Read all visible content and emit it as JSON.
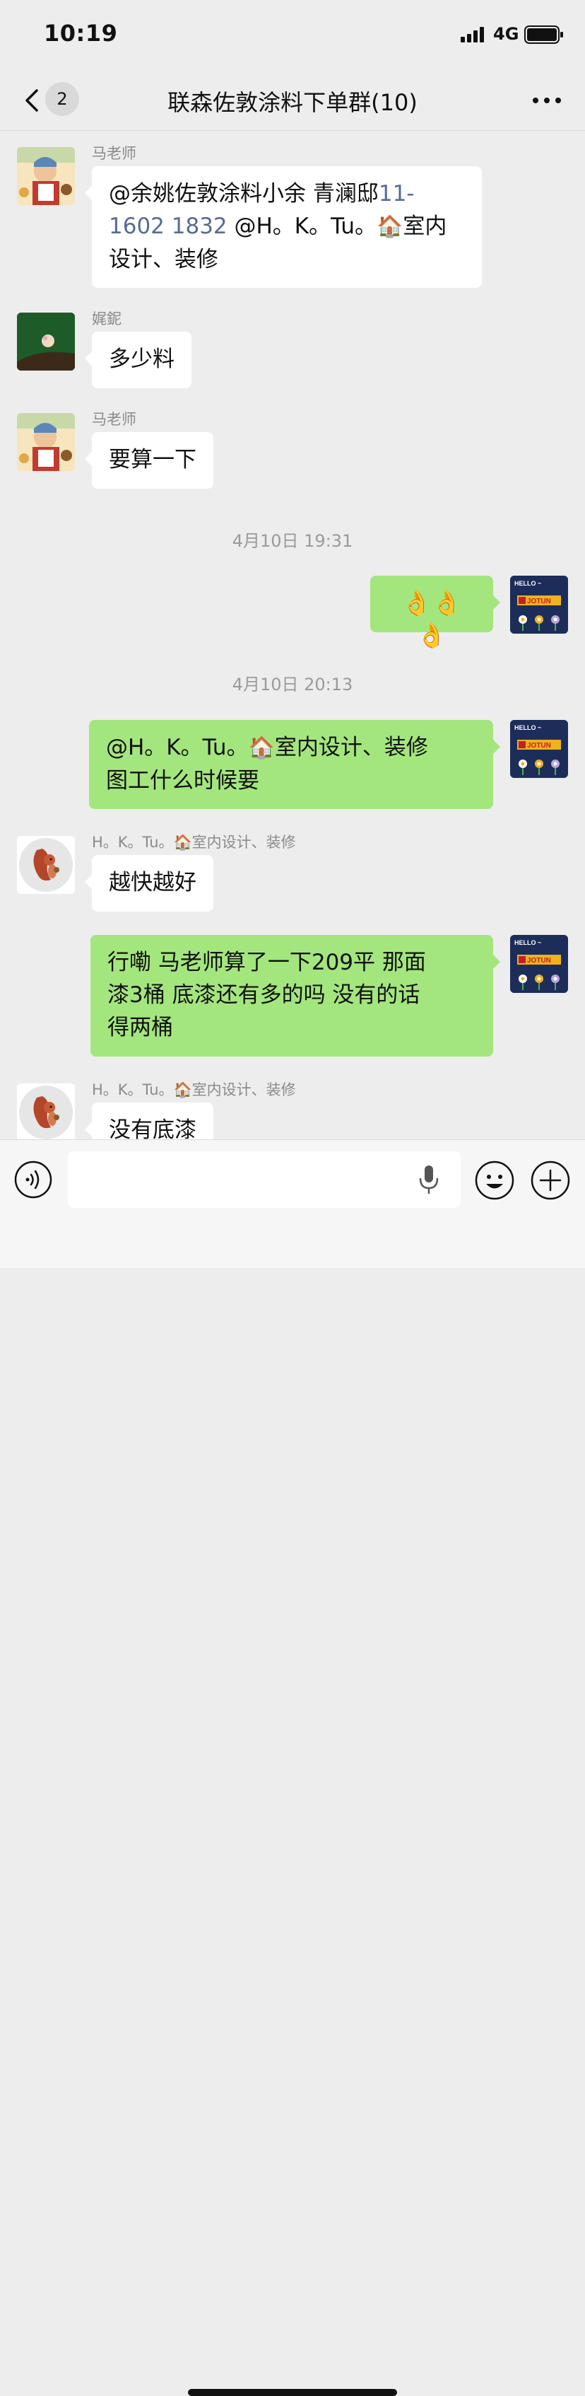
{
  "status_bar": {
    "time": "10:19",
    "network": "4G"
  },
  "nav": {
    "back_count": "2",
    "title": "联森佐敦涂料下单群(10)"
  },
  "messages": {
    "m1": {
      "sender": "马老师",
      "line1a": "@余姚佐敦涂料小余 青澜邸",
      "line1b": "11-",
      "line2a": "1602 1832",
      "line2b": " @H。K。Tu。",
      "line2c": "室内",
      "line3": "设计、装修"
    },
    "m2": {
      "sender": "娓鈮",
      "text": "多少料"
    },
    "m3": {
      "sender": "马老师",
      "text": "要算一下"
    },
    "ts1": "4月10日 19:31",
    "m4": {
      "text": "👌👌👌"
    },
    "ts2": "4月10日 20:13",
    "m5": {
      "line1a": "@H。K。Tu。",
      "line1b": "室内设计、装修",
      "line2": "图工什么时候要"
    },
    "m6": {
      "sender_a": "H。K。Tu。",
      "sender_b": "室内设计、装修",
      "text": "越快越好"
    },
    "m7": {
      "line1": "行嘞  马老师算了一下209平  那面",
      "line2": "漆3桶  底漆还有多的吗 没有的话",
      "line3": "得两桶"
    },
    "m8": {
      "sender_a": "H。K。Tu。",
      "sender_b": "室内设计、装修",
      "text": "没有底漆"
    }
  },
  "avatars": {
    "jotun_hello": "HELLO",
    "jotun_brand": "JOTUN"
  },
  "colors": {
    "background": "#ededed",
    "outgoing_bubble": "#a4e67e",
    "incoming_bubble": "#ffffff",
    "link": "#576b95"
  }
}
